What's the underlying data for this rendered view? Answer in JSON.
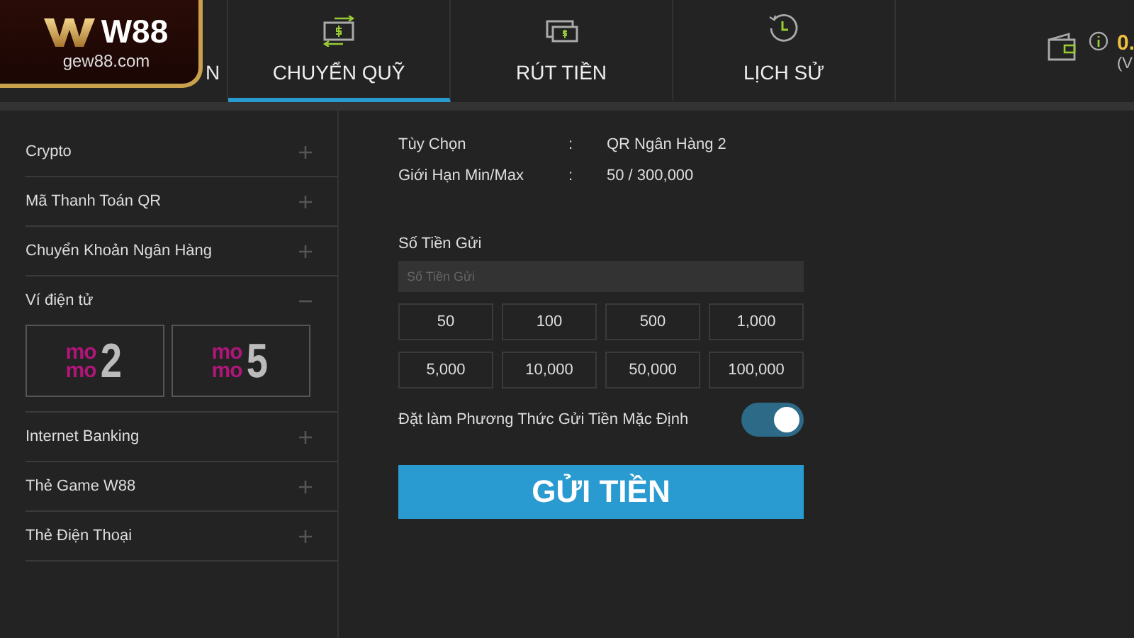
{
  "logo": {
    "brand": "W88",
    "domain": "gew88.com"
  },
  "tabs": [
    {
      "label": "N",
      "selected": false
    },
    {
      "label": "CHUYỂN QUỸ",
      "selected": true
    },
    {
      "label": "RÚT TIỀN",
      "selected": false
    },
    {
      "label": "LỊCH SỬ",
      "selected": false
    }
  ],
  "balance": {
    "amount": "0.",
    "currency": "(V"
  },
  "sidebar": {
    "items": [
      {
        "label": "Crypto",
        "expanded": false
      },
      {
        "label": "Mã Thanh Toán QR",
        "expanded": false
      },
      {
        "label": "Chuyển Khoản Ngân Hàng",
        "expanded": false
      },
      {
        "label": "Ví điện tử",
        "expanded": true,
        "options": [
          {
            "top": "mo",
            "bottom": "mo",
            "number": "2"
          },
          {
            "top": "mo",
            "bottom": "mo",
            "number": "5"
          }
        ]
      },
      {
        "label": "Internet Banking",
        "expanded": false
      },
      {
        "label": "Thẻ Game W88",
        "expanded": false
      },
      {
        "label": "Thẻ Điện Thoại",
        "expanded": false
      }
    ]
  },
  "details": [
    {
      "label": "Tùy Chọn",
      "separator": ":",
      "value": "QR Ngân Hàng 2"
    },
    {
      "label": "Giới Hạn Min/Max",
      "separator": ":",
      "value": "50 / 300,000"
    }
  ],
  "amount": {
    "label": "Số Tiền Gửi",
    "placeholder": "Số Tiền Gửi"
  },
  "presets": [
    "50",
    "100",
    "500",
    "1,000",
    "5,000",
    "10,000",
    "50,000",
    "100,000"
  ],
  "default_method": {
    "label": "Đặt làm Phương Thức Gửi Tiền Mặc Định",
    "on": true
  },
  "submit": "GỬI TIỀN"
}
